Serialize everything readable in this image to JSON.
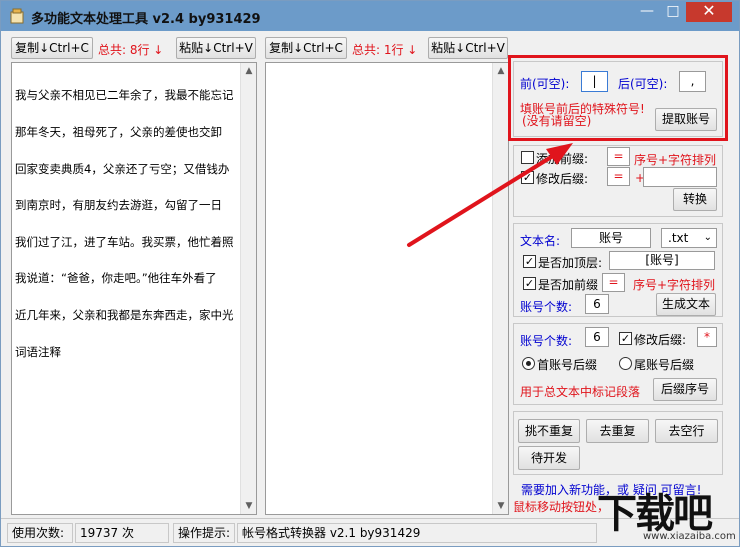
{
  "window": {
    "title": "多功能文本处理工具 v2.4 by931429",
    "min_glyph": "—",
    "max_glyph": "□",
    "close_glyph": "✕"
  },
  "left_toolbar": {
    "copy_label": "复制↓Ctrl+C",
    "total_label": "总共: 8行 ↓",
    "paste_label": "粘贴↓Ctrl+V"
  },
  "mid_toolbar": {
    "copy_label": "复制↓Ctrl+C",
    "total_label": "总共: 1行 ↓",
    "paste_label": "粘贴↓Ctrl+V"
  },
  "left_text": {
    "lines": [
      "我与父亲不相见已二年余了，我最不能忘记",
      "那年冬天，祖母死了，父亲的差使也交卸",
      "回家变卖典质4，父亲还了亏空；又借钱办",
      "到南京时，有朋友约去游逛，勾留了一日",
      "我们过了江，进了车站。我买票，他忙着照",
      "我说道：“爸爸，你走吧。”他往车外看了",
      "近几年来，父亲和我都是东奔西走，家中光",
      "词语注释"
    ]
  },
  "mid_text": {
    "lines": [
      ""
    ]
  },
  "extract_panel": {
    "front_label": "前(可空):",
    "front_value": "|",
    "back_label": "后(可空):",
    "back_value": ",",
    "hint_line1": "填账号前后的特殊符号!",
    "hint_line2": "(没有请留空)",
    "extract_button": "提取账号"
  },
  "suffix_panel": {
    "add_prefix_label": "添加前缀:",
    "add_prefix_checked": false,
    "add_prefix_value": "=",
    "add_prefix_hint": "序号+字符排列",
    "modify_suffix_label": "修改后缀:",
    "modify_suffix_checked": true,
    "modify_suffix_value": "=",
    "plus_sign": "+",
    "modify_suffix_extra": "",
    "convert_button": "转换"
  },
  "filename_panel": {
    "filename_label": "文本名:",
    "filename_value": "账号",
    "extension_value": ".txt",
    "add_top_label": "是否加顶层:",
    "add_top_checked": true,
    "add_top_value": "[账号]",
    "add_prefix_label": "是否加前缀",
    "add_prefix_checked": true,
    "add_prefix_value": "=",
    "add_prefix_hint": "序号+字符排列",
    "count_label": "账号个数:",
    "count_value": "6",
    "generate_button": "生成文本"
  },
  "seq_panel": {
    "count_label": "账号个数:",
    "count_value": "6",
    "modify_suffix_label": "修改后缀:",
    "modify_suffix_checked": true,
    "modify_suffix_value": "*",
    "radio_first_label": "首账号后缀",
    "radio_first_selected": true,
    "radio_last_label": "尾账号后缀",
    "radio_last_selected": false,
    "hint": "用于总文本中标记段落",
    "suffix_seq_button": "后缀序号"
  },
  "bottom_panel": {
    "pick_unique_button": "挑不重复",
    "dedupe_button": "去重复",
    "remove_blank_button": "去空行",
    "todo_button": "待开发"
  },
  "notes": {
    "line1": "需要加入新功能，或 疑问 可留言!",
    "line2": "鼠标移动按钮处，"
  },
  "status_bar": {
    "usage_label": "使用次数:",
    "usage_value": "19737 次",
    "hint_label": "操作提示:",
    "hint_value": "帐号格式转换器 v2.1 by931429"
  },
  "watermark": {
    "main": "下载吧",
    "url": "www.xiazaiba.com"
  },
  "colors": {
    "accent_red": "#e0141c",
    "label_blue": "#0000d0",
    "titlebar": "#6c9bc9"
  }
}
